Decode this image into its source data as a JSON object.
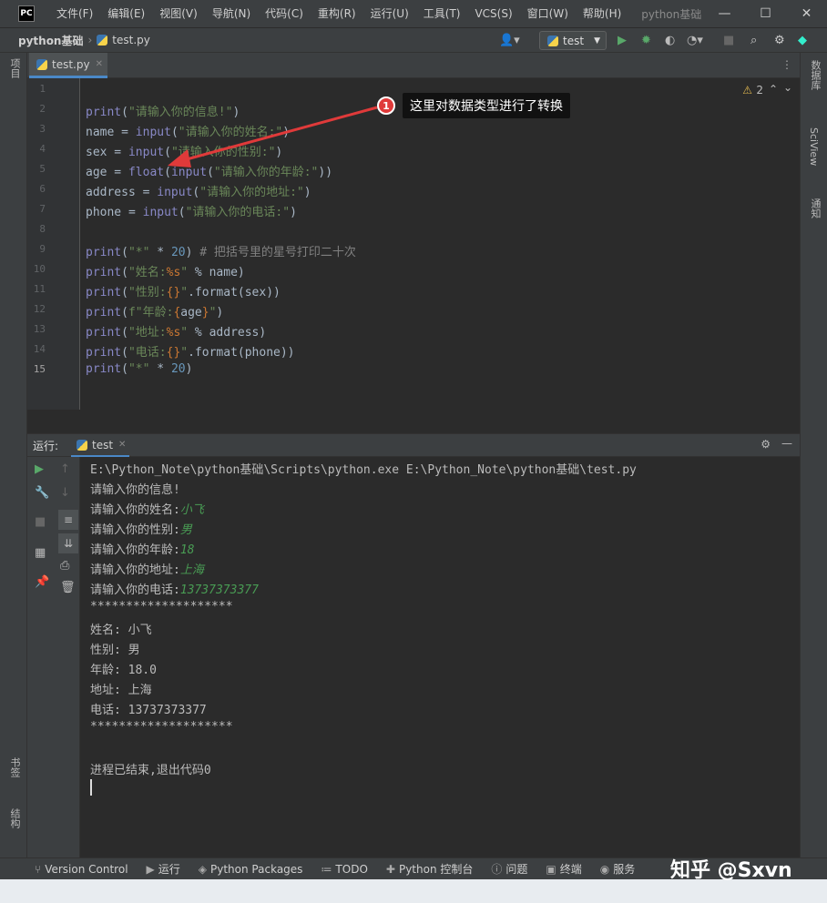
{
  "app": {
    "menu": [
      "文件(F)",
      "编辑(E)",
      "视图(V)",
      "导航(N)",
      "代码(C)",
      "重构(R)",
      "运行(U)",
      "工具(T)",
      "VCS(S)",
      "窗口(W)",
      "帮助(H)"
    ],
    "title": "python基础",
    "window_controls": [
      "—",
      "☐",
      "✕"
    ]
  },
  "navbar": {
    "project": "python基础",
    "file": "test.py",
    "run_config": "test"
  },
  "left_strip": {
    "project": "项目",
    "bookmarks": "书签",
    "structure": "结构"
  },
  "right_strip": {
    "database": "数据库",
    "sciview": "SciView",
    "notifications": "通知"
  },
  "editor": {
    "tab_label": "test.py",
    "warnings": "2",
    "lines": [
      "1",
      "2",
      "3",
      "4",
      "5",
      "6",
      "7",
      "8",
      "9",
      "10",
      "11",
      "12",
      "13",
      "14",
      "15"
    ]
  },
  "annotation": {
    "badge": "1",
    "callout": "这里对数据类型进行了转换"
  },
  "run": {
    "label": "运行:",
    "tab": "test",
    "cmd": "E:\\Python_Note\\python基础\\Scripts\\python.exe E:\\Python_Note\\python基础\\test.py",
    "prompt1": "请输入你的信息!",
    "p_name": "请输入你的姓名:",
    "v_name": "小飞",
    "p_sex": "请输入你的性别:",
    "v_sex": "男",
    "p_age": "请输入你的年龄:",
    "v_age": "18",
    "p_addr": "请输入你的地址:",
    "v_addr": "上海",
    "p_phone": "请输入你的电话:",
    "v_phone": "13737373377",
    "stars": "********************",
    "o_name": "姓名: 小飞",
    "o_sex": "性别: 男",
    "o_age": "年龄: 18.0",
    "o_addr": "地址: 上海",
    "o_phone": "电话: 13737373377",
    "stars2": "********************",
    "exit": "进程已结束,退出代码0"
  },
  "bottom_tabs": [
    "Version Control",
    "运行",
    "Python Packages",
    "TODO",
    "Python 控制台",
    "问题",
    "终端",
    "服务"
  ],
  "watermark": "知乎 @Sxvn",
  "colors": {
    "accent": "#4a88c7",
    "input_green": "#499c54",
    "badge_red": "#e03a3a"
  }
}
